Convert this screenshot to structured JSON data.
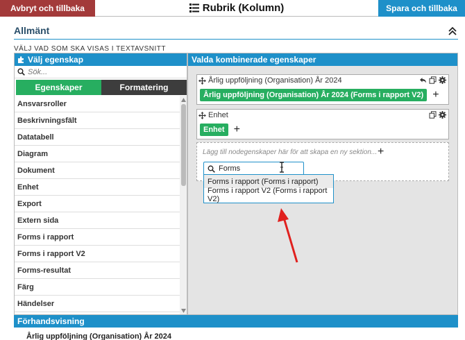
{
  "topbar": {
    "cancel_label": "Avbryt och tillbaka",
    "title": "Rubrik (Kolumn)",
    "title_icon": "list-icon",
    "save_label": "Spara och tillbaka"
  },
  "section": {
    "title": "Allmänt",
    "collapse_icon": "chevron-double-up-icon",
    "subheading": "VÄLJ VAD SOM SKA VISAS I TEXTAVSNITT"
  },
  "left_panel": {
    "header": "Välj egenskap",
    "header_icon": "puzzle-icon",
    "search_placeholder": "Sök...",
    "tabs": [
      {
        "label": "Egenskaper",
        "active": true
      },
      {
        "label": "Formatering",
        "active": false
      }
    ],
    "items": [
      {
        "label": "Ansvarsroller"
      },
      {
        "label": "Beskrivningsfält"
      },
      {
        "label": "Datatabell"
      },
      {
        "label": "Diagram"
      },
      {
        "label": "Dokument"
      },
      {
        "label": "Enhet"
      },
      {
        "label": "Export"
      },
      {
        "label": "Extern sida"
      },
      {
        "label": "Forms i rapport"
      },
      {
        "label": "Forms i rapport V2"
      },
      {
        "label": "Forms-resultat"
      },
      {
        "label": "Färg"
      },
      {
        "label": "Händelser"
      }
    ]
  },
  "right_panel": {
    "header": "Valda kombinerade egenskaper",
    "cards": [
      {
        "title": "Årlig uppföljning (Organisation) År 2024",
        "chip": "Årlig uppföljning (Organisation) År 2024 (Forms i rapport V2)"
      },
      {
        "title": "Enhet",
        "chip": "Enhet"
      }
    ],
    "dropzone_text": "Lägg till nodegenskaper här för att skapa en ny sektion...",
    "dropzone_search_value": "Forms",
    "dropdown_items": [
      {
        "label": "Forms i rapport (Forms i rapport)",
        "highlighted": true
      },
      {
        "label": "Forms i rapport V2 (Forms i rapport V2)",
        "highlighted": false
      }
    ]
  },
  "preview": {
    "header": "Förhandsvisning",
    "text": "Årlig uppföljning (Organisation) År 2024"
  },
  "colors": {
    "cancel": "#a33a3a",
    "accent": "#1e90c9",
    "chip": "#27ae60",
    "arrow": "#e0201e"
  }
}
